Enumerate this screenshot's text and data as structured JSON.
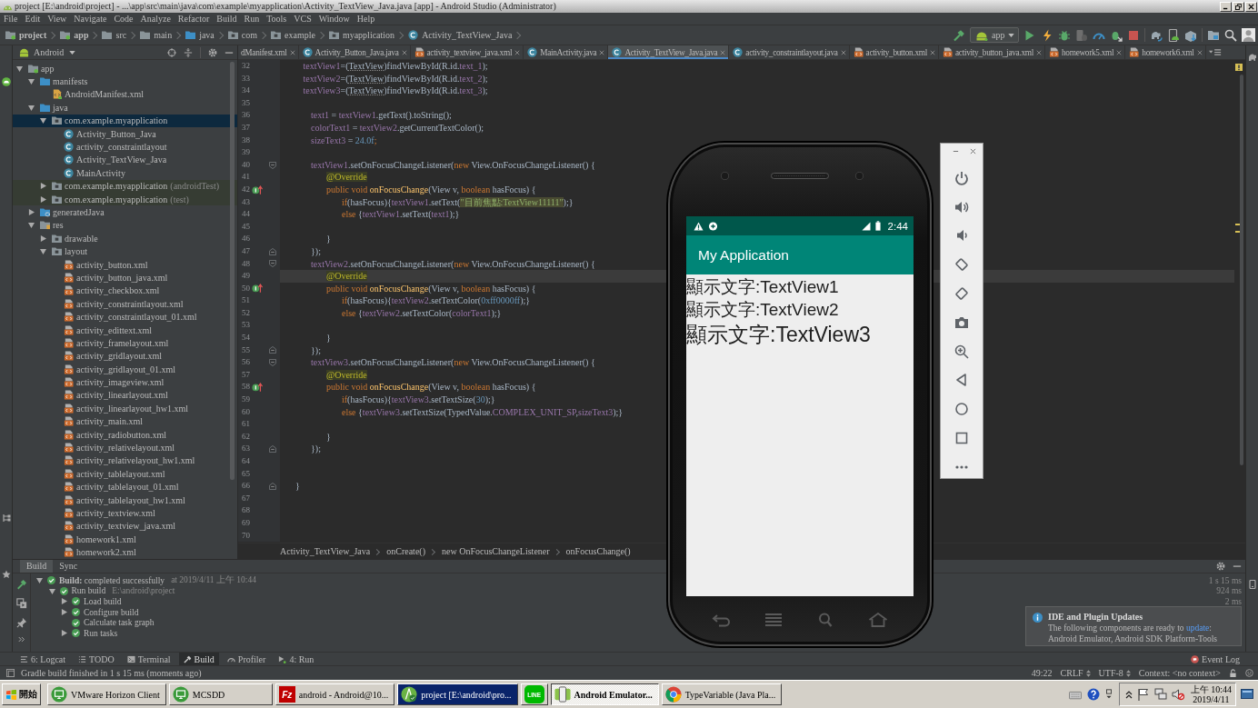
{
  "window": {
    "title": "project [E:\\android\\project] - ...\\app\\src\\main\\java\\com\\example\\myapplication\\Activity_TextView_Java.java [app] - Android Studio (Administrator)"
  },
  "menu": [
    "File",
    "Edit",
    "View",
    "Navigate",
    "Code",
    "Analyze",
    "Refactor",
    "Build",
    "Run",
    "Tools",
    "VCS",
    "Window",
    "Help"
  ],
  "navigation_bar": {
    "path": [
      {
        "label": "project",
        "kind": "module"
      },
      {
        "label": "app",
        "kind": "module"
      },
      {
        "label": "src",
        "kind": "folder"
      },
      {
        "label": "main",
        "kind": "folder"
      },
      {
        "label": "java",
        "kind": "source-folder"
      },
      {
        "label": "com",
        "kind": "package"
      },
      {
        "label": "example",
        "kind": "package"
      },
      {
        "label": "myapplication",
        "kind": "package"
      },
      {
        "label": "Activity_TextView_Java",
        "kind": "class"
      }
    ],
    "run_configuration": "app"
  },
  "project_panel": {
    "view": "Android",
    "tree": [
      {
        "label": "app",
        "kind": "module",
        "expanded": true,
        "selected": false,
        "children": [
          {
            "label": "manifests",
            "kind": "source-folder",
            "expanded": true,
            "selected": false,
            "children": [
              {
                "label": "AndroidManifest.xml",
                "kind": "manifest",
                "selected": false
              }
            ]
          },
          {
            "label": "java",
            "kind": "source-folder",
            "expanded": true,
            "selected": false,
            "children": [
              {
                "label": "com.example.myapplication",
                "kind": "package",
                "expanded": true,
                "selected": true,
                "children": [
                  {
                    "label": "Activity_Button_Java",
                    "kind": "class",
                    "selected": false
                  },
                  {
                    "label": "activity_constraintlayout",
                    "kind": "class",
                    "selected": false
                  },
                  {
                    "label": "Activity_TextView_Java",
                    "kind": "class",
                    "selected": false
                  },
                  {
                    "label": "MainActivity",
                    "kind": "class",
                    "selected": false
                  }
                ]
              },
              {
                "label": "com.example.myapplication",
                "suffix": "(androidTest)",
                "kind": "test-package",
                "expanded": false,
                "selected": false
              },
              {
                "label": "com.example.myapplication",
                "suffix": "(test)",
                "kind": "test-package",
                "expanded": false,
                "selected": false
              }
            ]
          },
          {
            "label": "generatedJava",
            "kind": "generated",
            "expanded": false,
            "selected": false
          },
          {
            "label": "res",
            "kind": "res",
            "expanded": true,
            "selected": false,
            "children": [
              {
                "label": "drawable",
                "kind": "package",
                "expanded": false,
                "selected": false
              },
              {
                "label": "layout",
                "kind": "package",
                "expanded": true,
                "selected": false,
                "children": [
                  {
                    "label": "activity_button.xml",
                    "kind": "xml",
                    "selected": false
                  },
                  {
                    "label": "activity_button_java.xml",
                    "kind": "xml",
                    "selected": false
                  },
                  {
                    "label": "activity_checkbox.xml",
                    "kind": "xml",
                    "selected": false
                  },
                  {
                    "label": "activity_constraintlayout.xml",
                    "kind": "xml",
                    "selected": false
                  },
                  {
                    "label": "activity_constraintlayout_01.xml",
                    "kind": "xml",
                    "selected": false
                  },
                  {
                    "label": "activity_edittext.xml",
                    "kind": "xml",
                    "selected": false
                  },
                  {
                    "label": "activity_framelayout.xml",
                    "kind": "xml",
                    "selected": false
                  },
                  {
                    "label": "activity_gridlayout.xml",
                    "kind": "xml",
                    "selected": false
                  },
                  {
                    "label": "activity_gridlayout_01.xml",
                    "kind": "xml",
                    "selected": false
                  },
                  {
                    "label": "activity_imageview.xml",
                    "kind": "xml",
                    "selected": false
                  },
                  {
                    "label": "activity_linearlayout.xml",
                    "kind": "xml",
                    "selected": false
                  },
                  {
                    "label": "activity_linearlayout_hw1.xml",
                    "kind": "xml",
                    "selected": false
                  },
                  {
                    "label": "activity_main.xml",
                    "kind": "xml",
                    "selected": false
                  },
                  {
                    "label": "activity_radiobutton.xml",
                    "kind": "xml",
                    "selected": false
                  },
                  {
                    "label": "activity_relativelayout.xml",
                    "kind": "xml",
                    "selected": false
                  },
                  {
                    "label": "activity_relativelayout_hw1.xml",
                    "kind": "xml",
                    "selected": false
                  },
                  {
                    "label": "activity_tablelayout.xml",
                    "kind": "xml",
                    "selected": false
                  },
                  {
                    "label": "activity_tablelayout_01.xml",
                    "kind": "xml",
                    "selected": false
                  },
                  {
                    "label": "activity_tablelayout_hw1.xml",
                    "kind": "xml",
                    "selected": false
                  },
                  {
                    "label": "activity_textview.xml",
                    "kind": "xml",
                    "selected": false
                  },
                  {
                    "label": "activity_textview_java.xml",
                    "kind": "xml",
                    "selected": false
                  },
                  {
                    "label": "homework1.xml",
                    "kind": "xml",
                    "selected": false
                  },
                  {
                    "label": "homework2.xml",
                    "kind": "xml",
                    "selected": false
                  }
                ]
              }
            ]
          }
        ]
      }
    ]
  },
  "editor": {
    "tabs": [
      {
        "label": "dManifest.xml",
        "selected": false
      },
      {
        "label": "Activity_Button_Java.java",
        "kind": "class",
        "selected": false
      },
      {
        "label": "activity_textview_java.xml",
        "kind": "xml",
        "selected": false
      },
      {
        "label": "MainActivity.java",
        "kind": "class",
        "selected": false
      },
      {
        "label": "Activity_TextView_Java.java",
        "kind": "class",
        "selected": true
      },
      {
        "label": "activity_constraintlayout.java",
        "kind": "class",
        "selected": false
      },
      {
        "label": "activity_button.xml",
        "kind": "xml",
        "selected": false
      },
      {
        "label": "activity_button_java.xml",
        "kind": "xml",
        "selected": false
      },
      {
        "label": "homework5.xml",
        "kind": "xml",
        "selected": false
      },
      {
        "label": "homework6.xml",
        "kind": "xml",
        "selected": false
      }
    ],
    "lines": [
      {
        "number": "32",
        "kind": "plain",
        "current": false,
        "tokens": [
          {
            "kind": "field",
            "text": "      textView1"
          },
          {
            "kind": "plain",
            "text": "=("
          },
          {
            "kind": "type",
            "text": "TextView"
          },
          {
            "kind": "plain",
            "text": ")findViewById(R.id."
          },
          {
            "kind": "field",
            "text": "text_1"
          },
          {
            "kind": "plain",
            "text": ");"
          }
        ]
      },
      {
        "number": "33",
        "kind": "plain",
        "current": false,
        "tokens": [
          {
            "kind": "field",
            "text": "      textView2"
          },
          {
            "kind": "plain",
            "text": "=("
          },
          {
            "kind": "type",
            "text": "TextView"
          },
          {
            "kind": "plain",
            "text": ")findViewById(R.id."
          },
          {
            "kind": "field",
            "text": "text_2"
          },
          {
            "kind": "plain",
            "text": ");"
          }
        ]
      },
      {
        "number": "34",
        "kind": "plain",
        "current": false,
        "tokens": [
          {
            "kind": "field",
            "text": "      textView3"
          },
          {
            "kind": "plain",
            "text": "=("
          },
          {
            "kind": "type",
            "text": "TextView"
          },
          {
            "kind": "plain",
            "text": ")findViewById(R.id."
          },
          {
            "kind": "field",
            "text": "text_3"
          },
          {
            "kind": "plain",
            "text": ");"
          }
        ]
      },
      {
        "number": "35",
        "kind": "plain",
        "current": false
      },
      {
        "number": "36",
        "kind": "plain",
        "current": false,
        "tokens": [
          {
            "kind": "field",
            "text": "        text1"
          },
          {
            "kind": "plain",
            "text": " = "
          },
          {
            "kind": "field",
            "text": "textView1"
          },
          {
            "kind": "plain",
            "text": ".getText().toString();"
          }
        ]
      },
      {
        "number": "37",
        "kind": "plain",
        "current": false,
        "tokens": [
          {
            "kind": "field",
            "text": "        colorText1"
          },
          {
            "kind": "plain",
            "text": " = "
          },
          {
            "kind": "field",
            "text": "textView2"
          },
          {
            "kind": "plain",
            "text": ".getCurrentTextColor();"
          }
        ]
      },
      {
        "number": "38",
        "kind": "plain",
        "current": false,
        "tokens": [
          {
            "kind": "field",
            "text": "        sizeText3"
          },
          {
            "kind": "plain",
            "text": " = "
          },
          {
            "kind": "number",
            "text": "24.0f"
          },
          {
            "kind": "keyword",
            "text": ";"
          }
        ]
      },
      {
        "number": "39",
        "kind": "plain",
        "current": false
      },
      {
        "number": "40",
        "kind": "fold-start",
        "current": false,
        "tokens": [
          {
            "kind": "field",
            "text": "        textView1"
          },
          {
            "kind": "plain",
            "text": ".setOnFocusChangeListener("
          },
          {
            "kind": "keyword",
            "text": "new"
          },
          {
            "kind": "plain",
            "text": " View.OnFocusChangeListener() {"
          }
        ]
      },
      {
        "number": "41",
        "kind": "plain",
        "current": false,
        "tokens": [
          {
            "kind": "annotation",
            "text": "            @Override"
          }
        ]
      },
      {
        "number": "42",
        "kind": "override",
        "current": false,
        "tokens": [
          {
            "kind": "keyword",
            "text": "            public void "
          },
          {
            "kind": "method",
            "text": "onFocusChange"
          },
          {
            "kind": "plain",
            "text": "(View v, "
          },
          {
            "kind": "keyword",
            "text": "boolean "
          },
          {
            "kind": "plain",
            "text": "hasFocus) {"
          }
        ]
      },
      {
        "number": "43",
        "kind": "plain",
        "current": false,
        "tokens": [
          {
            "kind": "keyword",
            "text": "                if"
          },
          {
            "kind": "plain",
            "text": "(hasFocus){"
          },
          {
            "kind": "field",
            "text": "textView1"
          },
          {
            "kind": "plain",
            "text": ".setText("
          },
          {
            "kind": "string",
            "text": "\"目前焦點:TextView11111\""
          },
          {
            "kind": "plain",
            "text": ");}"
          }
        ]
      },
      {
        "number": "44",
        "kind": "plain",
        "current": false,
        "tokens": [
          {
            "kind": "keyword",
            "text": "                else "
          },
          {
            "kind": "plain",
            "text": "{"
          },
          {
            "kind": "field",
            "text": "textView1"
          },
          {
            "kind": "plain",
            "text": ".setText("
          },
          {
            "kind": "field",
            "text": "text1"
          },
          {
            "kind": "plain",
            "text": ");}"
          }
        ]
      },
      {
        "number": "45",
        "kind": "plain",
        "current": false
      },
      {
        "number": "46",
        "kind": "plain",
        "current": false,
        "tokens": [
          {
            "kind": "plain",
            "text": "            }"
          }
        ]
      },
      {
        "number": "47",
        "kind": "fold-end",
        "current": false,
        "tokens": [
          {
            "kind": "plain",
            "text": "        });"
          }
        ]
      },
      {
        "number": "48",
        "kind": "fold-start",
        "current": false,
        "tokens": [
          {
            "kind": "field",
            "text": "        textView2"
          },
          {
            "kind": "plain",
            "text": ".setOnFocusChangeListener("
          },
          {
            "kind": "keyword",
            "text": "new"
          },
          {
            "kind": "plain",
            "text": " View.OnFocusChangeListener() {"
          }
        ]
      },
      {
        "number": "49",
        "kind": "plain",
        "current": true,
        "tokens": [
          {
            "kind": "annotation",
            "text": "            @Override"
          }
        ]
      },
      {
        "number": "50",
        "kind": "override",
        "current": false,
        "tokens": [
          {
            "kind": "keyword",
            "text": "            public void "
          },
          {
            "kind": "method",
            "text": "onFocusChange"
          },
          {
            "kind": "plain",
            "text": "(View v, "
          },
          {
            "kind": "keyword",
            "text": "boolean "
          },
          {
            "kind": "plain",
            "text": "hasFocus) {"
          }
        ]
      },
      {
        "number": "51",
        "kind": "plain",
        "current": false,
        "tokens": [
          {
            "kind": "keyword",
            "text": "                if"
          },
          {
            "kind": "plain",
            "text": "(hasFocus){"
          },
          {
            "kind": "field",
            "text": "textView2"
          },
          {
            "kind": "plain",
            "text": ".setTextColor("
          },
          {
            "kind": "number",
            "text": "0xff0000ff"
          },
          {
            "kind": "plain",
            "text": ");}"
          }
        ]
      },
      {
        "number": "52",
        "kind": "plain",
        "current": false,
        "tokens": [
          {
            "kind": "keyword",
            "text": "                else "
          },
          {
            "kind": "plain",
            "text": "{"
          },
          {
            "kind": "field",
            "text": "textView2"
          },
          {
            "kind": "plain",
            "text": ".setTextColor("
          },
          {
            "kind": "field",
            "text": "colorText1"
          },
          {
            "kind": "plain",
            "text": ");}"
          }
        ]
      },
      {
        "number": "53",
        "kind": "plain",
        "current": false
      },
      {
        "number": "54",
        "kind": "plain",
        "current": false,
        "tokens": [
          {
            "kind": "plain",
            "text": "            }"
          }
        ]
      },
      {
        "number": "55",
        "kind": "fold-end",
        "current": false,
        "tokens": [
          {
            "kind": "plain",
            "text": "        });"
          }
        ]
      },
      {
        "number": "56",
        "kind": "fold-start",
        "current": false,
        "tokens": [
          {
            "kind": "field",
            "text": "        textView3"
          },
          {
            "kind": "plain",
            "text": ".setOnFocusChangeListener("
          },
          {
            "kind": "keyword",
            "text": "new"
          },
          {
            "kind": "plain",
            "text": " View.OnFocusChangeListener() {"
          }
        ]
      },
      {
        "number": "57",
        "kind": "plain",
        "current": false,
        "tokens": [
          {
            "kind": "annotation",
            "text": "            @Override"
          }
        ]
      },
      {
        "number": "58",
        "kind": "override",
        "current": false,
        "tokens": [
          {
            "kind": "keyword",
            "text": "            public void "
          },
          {
            "kind": "method",
            "text": "onFocusChange"
          },
          {
            "kind": "plain",
            "text": "(View v, "
          },
          {
            "kind": "keyword",
            "text": "boolean "
          },
          {
            "kind": "plain",
            "text": "hasFocus) {"
          }
        ]
      },
      {
        "number": "59",
        "kind": "plain",
        "current": false,
        "tokens": [
          {
            "kind": "keyword",
            "text": "                if"
          },
          {
            "kind": "plain",
            "text": "(hasFocus){"
          },
          {
            "kind": "field",
            "text": "textView3"
          },
          {
            "kind": "plain",
            "text": ".setTextSize("
          },
          {
            "kind": "number",
            "text": "30"
          },
          {
            "kind": "plain",
            "text": ");}"
          }
        ]
      },
      {
        "number": "60",
        "kind": "plain",
        "current": false,
        "tokens": [
          {
            "kind": "keyword",
            "text": "                else "
          },
          {
            "kind": "plain",
            "text": "{"
          },
          {
            "kind": "field",
            "text": "textView3"
          },
          {
            "kind": "plain",
            "text": ".setTextSize(TypedValue."
          },
          {
            "kind": "constant",
            "text": "COMPLEX_UNIT_SP"
          },
          {
            "kind": "plain",
            "text": ","
          },
          {
            "kind": "field",
            "text": "sizeText3"
          },
          {
            "kind": "plain",
            "text": ");}"
          }
        ]
      },
      {
        "number": "61",
        "kind": "plain",
        "current": false
      },
      {
        "number": "62",
        "kind": "plain",
        "current": false,
        "tokens": [
          {
            "kind": "plain",
            "text": "            }"
          }
        ]
      },
      {
        "number": "63",
        "kind": "fold-end",
        "current": false,
        "tokens": [
          {
            "kind": "plain",
            "text": "        });"
          }
        ]
      },
      {
        "number": "64",
        "kind": "plain",
        "current": false
      },
      {
        "number": "65",
        "kind": "plain",
        "current": false
      },
      {
        "number": "66",
        "kind": "fold-end",
        "current": false,
        "tokens": [
          {
            "kind": "plain",
            "text": "    }"
          }
        ]
      },
      {
        "number": "67",
        "kind": "plain",
        "current": false
      },
      {
        "number": "68",
        "kind": "plain",
        "current": false
      },
      {
        "number": "69",
        "kind": "plain",
        "current": false
      },
      {
        "number": "70",
        "kind": "plain",
        "current": false
      }
    ],
    "breadcrumb": [
      "Activity_TextView_Java",
      "onCreate()",
      "new OnFocusChangeListener",
      "onFocusChange()"
    ]
  },
  "emulator": {
    "status_time": "2:44",
    "app_title": "My Application",
    "texts": [
      {
        "text": "顯示文字:TextView1",
        "kind": "normal"
      },
      {
        "text": "顯示文字:TextView2",
        "kind": "normal"
      },
      {
        "text": "顯示文字:TextView3",
        "kind": "large"
      }
    ]
  },
  "build_panel": {
    "tabs": [
      {
        "label": "Build",
        "selected": true
      },
      {
        "label": "Sync",
        "selected": false
      }
    ],
    "tree": [
      {
        "label": "**Build:** completed successfully",
        "detail": "at 2019/4/11 上午 10:44",
        "duration": "1 s 15 ms",
        "expanded": true,
        "children": [
          {
            "label": "Run build",
            "detail": "E:\\android\\project",
            "duration": "924 ms",
            "expanded": true,
            "children": [
              {
                "label": "Load build",
                "duration": "2 ms",
                "expanded": false
              },
              {
                "label": "Configure build",
                "expanded": false
              },
              {
                "label": "Calculate task graph"
              },
              {
                "label": "Run tasks",
                "expanded": false
              }
            ]
          }
        ]
      }
    ]
  },
  "notification": {
    "title": "IDE and Plugin Updates",
    "text_before": "The following components are ready to ",
    "link": "update",
    "text_after": ": Android Emulator, Android SDK Platform-Tools"
  },
  "tool_window_bar": {
    "tabs": [
      {
        "label": "6: Logcat",
        "kind": "logcat",
        "selected": false
      },
      {
        "label": "TODO",
        "kind": "todo",
        "selected": false
      },
      {
        "label": "Terminal",
        "kind": "terminal",
        "selected": false
      },
      {
        "label": "Build",
        "kind": "build",
        "selected": true
      },
      {
        "label": "Profiler",
        "kind": "profiler",
        "selected": false
      },
      {
        "label": "4: Run",
        "kind": "run",
        "selected": false
      }
    ],
    "event_log": "Event Log"
  },
  "status_bar": {
    "message": "Gradle build finished in 1 s 15 ms (moments ago)",
    "position": "49:22",
    "line_separator": "CRLF",
    "encoding": "UTF-8",
    "context": "Context: <no context>"
  },
  "taskbar": {
    "start": "開始",
    "items": [
      {
        "label": "VMware Horizon Client",
        "kind": "remote",
        "selected": false,
        "flashing": false
      },
      {
        "label": "MCSDD",
        "kind": "remote",
        "selected": false,
        "flashing": false
      },
      {
        "label": "android - Android@10...",
        "kind": "ftp",
        "logo": "Fz",
        "selected": false,
        "flashing": false
      },
      {
        "label": "project [E:\\android\\pro...",
        "kind": "studio",
        "selected": false,
        "flashing": true
      },
      {
        "kind": "chat",
        "logo": "LINE",
        "selected": false,
        "flashing": false
      },
      {
        "label": "Android Emulator...",
        "kind": "emulator",
        "selected": true,
        "flashing": false
      },
      {
        "label": "TypeVariable (Java Pla...",
        "kind": "browser",
        "selected": false,
        "flashing": false
      }
    ],
    "clock": {
      "time": "上午 10:44",
      "date": "2019/4/11"
    }
  }
}
